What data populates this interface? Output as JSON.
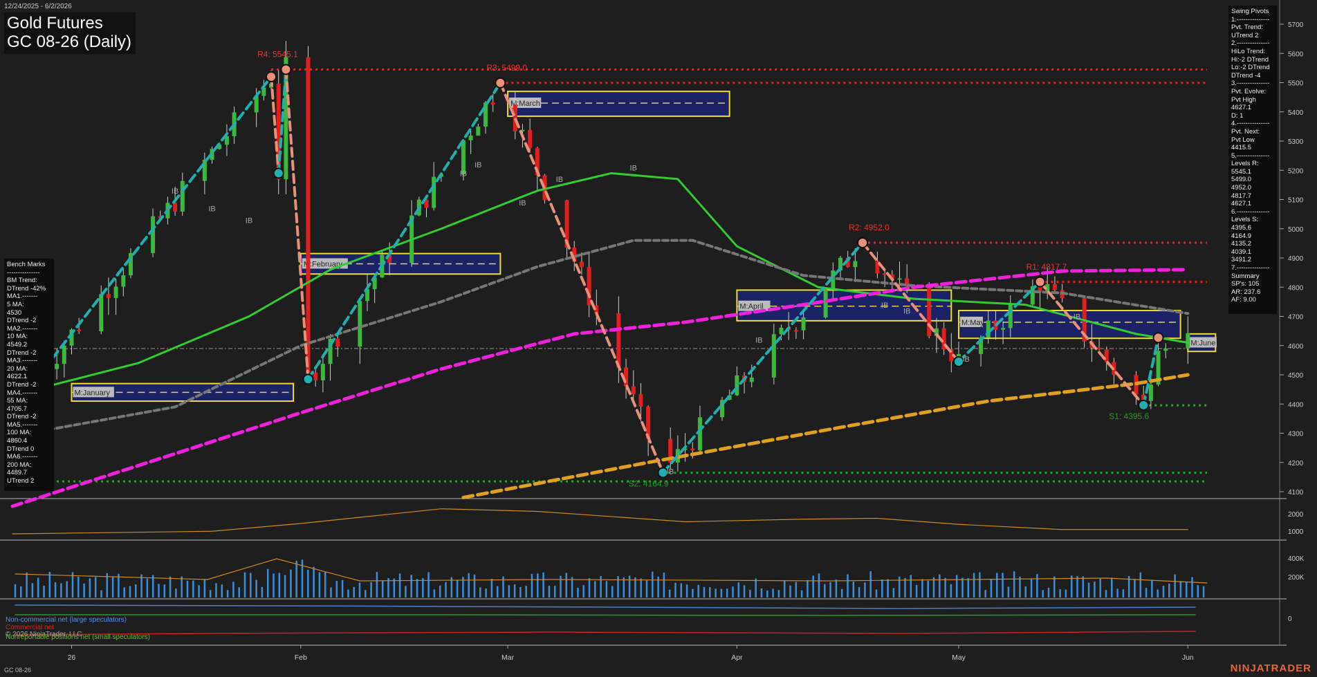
{
  "header": {
    "date_range": "12/24/2025 - 6/2/2026",
    "title_line1": "Gold Futures",
    "title_line2": "GC 08-26 (Daily)"
  },
  "swing_panel_lines": [
    "Swing Pivots",
    "1.---------------",
    "Pvt. Trend:",
    "UTrend 2",
    "2.---------------",
    "HiLo Trend:",
    "Hi:-2 DTrend",
    "Lo:-2 DTrend",
    "DTrend -4",
    "3.---------------",
    "Pvt. Evolve:",
    "Pvt High",
    "4627.1",
    "D: 1",
    "4.---------------",
    "Pvt. Next:",
    "Pvt Low",
    "4415.5",
    "5.---------------",
    "Levels R:",
    "5545.1",
    "5499.0",
    "4952.0",
    "4817.7",
    "4627.1",
    "6.---------------",
    "Levels S:",
    "4395.6",
    "4164.9",
    "4135.2",
    "4039.1",
    "3491.2",
    "7.---------------",
    "Summary",
    "SP's: 105",
    "AR: 237.6",
    "AF: 9.00"
  ],
  "bench_panel_lines": [
    "Bench Marks",
    "---------------",
    "BM Trend:",
    "DTrend -42%",
    "MA1.-------",
    "5 MA:",
    "4530",
    "DTrend -2",
    "MA2.-------",
    "10 MA:",
    "4549.2",
    "DTrend -2",
    "MA3.-------",
    "20 MA:",
    "4622.1",
    "DTrend -2",
    "MA4.-------",
    "55 MA:",
    "4705.7",
    "DTrend -2",
    "MA5.-------",
    "100 MA:",
    "4860.4",
    "DTrend 0",
    "MA6.-------",
    "200 MA:",
    "4489.7",
    "UTrend 2"
  ],
  "legend": {
    "noncommercial": "Non-commercial net (large speculators)",
    "commercial": "Commercial net",
    "nonreportable": "Nonreportable positions net (small speculators)",
    "copyright": "© 2026 NinjaTrader, LLC"
  },
  "footer": {
    "symbol": "GC 08-26",
    "brand": "NINJATRADER"
  },
  "colors": {
    "background": "#1e1e1e",
    "up_candle": "#3cb83c",
    "down_candle": "#e02020",
    "ma_green": "#33cc33",
    "ma_gray": "#777777",
    "ma_magenta": "#ee22dd",
    "ma_orange": "#e0a020",
    "pivot_teal": "#20b0b0",
    "pivot_salmon": "#e8907a",
    "resistance": "#ee2222",
    "support": "#22aa22",
    "volume": "#3a8fe0"
  },
  "chart_data": {
    "type": "candlestick",
    "y_axis": {
      "ticks": [
        4100,
        4200,
        4300,
        4400,
        4500,
        4600,
        4700,
        4800,
        4900,
        5000,
        5100,
        5200,
        5300,
        5400,
        5500,
        5600,
        5700
      ],
      "range": [
        4080,
        5760
      ]
    },
    "x_axis": {
      "tick_labels": [
        {
          "label": "26",
          "date": "2026-01-01"
        },
        {
          "label": "Feb",
          "date": "2026-02-01"
        },
        {
          "label": "Mar",
          "date": "2026-03-01"
        },
        {
          "label": "Apr",
          "date": "2026-04-01"
        },
        {
          "label": "May",
          "date": "2026-05-01"
        },
        {
          "label": "Jun",
          "date": "2026-06-01"
        }
      ],
      "range": [
        "2025-12-24",
        "2026-06-02"
      ]
    },
    "resistance_levels": [
      {
        "label": "R4: 5545.1",
        "value": 5545.1,
        "start": "2026-01-28"
      },
      {
        "label": "R3: 5499.0",
        "value": 5499.0,
        "start": "2026-02-28"
      },
      {
        "label": "R2: 4952.0",
        "value": 4952.0,
        "start": "2026-04-18"
      },
      {
        "label": "R1: 4817.7",
        "value": 4817.7,
        "start": "2026-05-12"
      }
    ],
    "support_levels": [
      {
        "label": "S1: 4395.6",
        "value": 4395.6,
        "start": "2026-05-26"
      },
      {
        "label": "S2: 4164.9",
        "value": 4164.9,
        "start": "2026-03-22"
      },
      {
        "label": "",
        "value": 4135.2,
        "start": "2025-12-24"
      }
    ],
    "monthly_boxes": [
      {
        "label": "M:January",
        "start": "2026-01-01",
        "end": "2026-01-31",
        "high": 4470,
        "low": 4410,
        "mid": 4440
      },
      {
        "label": "M:February",
        "start": "2026-02-01",
        "end": "2026-02-28",
        "high": 4915,
        "low": 4845,
        "mid": 4880
      },
      {
        "label": "M:March",
        "start": "2026-03-01",
        "end": "2026-03-31",
        "high": 5470,
        "low": 5385,
        "mid": 5430
      },
      {
        "label": "M:April",
        "start": "2026-04-01",
        "end": "2026-04-30",
        "high": 4790,
        "low": 4685,
        "mid": 4735
      },
      {
        "label": "M:May",
        "start": "2026-05-01",
        "end": "2026-05-31",
        "high": 4720,
        "low": 4625,
        "mid": 4680
      },
      {
        "label": "M:June",
        "start": "2026-06-01",
        "end": "2026-06-02",
        "high": 4640,
        "low": 4580,
        "mid": 4610
      }
    ],
    "pivot_swings": [
      {
        "date": "2025-12-24",
        "value": 4380
      },
      {
        "date": "2026-01-28",
        "value": 5520
      },
      {
        "date": "2026-01-29",
        "value": 5190
      },
      {
        "date": "2026-01-30",
        "value": 5545
      },
      {
        "date": "2026-02-02",
        "value": 4485
      },
      {
        "date": "2026-02-28",
        "value": 5499
      },
      {
        "date": "2026-03-22",
        "value": 4165
      },
      {
        "date": "2026-04-18",
        "value": 4952
      },
      {
        "date": "2026-05-01",
        "value": 4545
      },
      {
        "date": "2026-05-12",
        "value": 4818
      },
      {
        "date": "2026-05-26",
        "value": 4396
      },
      {
        "date": "2026-05-28",
        "value": 4627
      }
    ],
    "ib_markers": [
      {
        "date": "2026-01-15",
        "value": 5120
      },
      {
        "date": "2026-01-20",
        "value": 5060
      },
      {
        "date": "2026-01-25",
        "value": 5020
      },
      {
        "date": "2026-02-23",
        "value": 5180
      },
      {
        "date": "2026-02-25",
        "value": 5210
      },
      {
        "date": "2026-03-03",
        "value": 5080
      },
      {
        "date": "2026-03-08",
        "value": 5160
      },
      {
        "date": "2026-03-18",
        "value": 5200
      },
      {
        "date": "2026-03-23",
        "value": 4160
      },
      {
        "date": "2026-04-04",
        "value": 4610
      },
      {
        "date": "2026-04-21",
        "value": 4730
      },
      {
        "date": "2026-04-24",
        "value": 4710
      },
      {
        "date": "2026-05-02",
        "value": 4545
      },
      {
        "date": "2026-05-17",
        "value": 4690
      }
    ],
    "moving_averages": [
      {
        "name": "green",
        "points": [
          [
            "2025-12-24",
            4430
          ],
          [
            "2026-01-10",
            4540
          ],
          [
            "2026-01-25",
            4700
          ],
          [
            "2026-02-05",
            4860
          ],
          [
            "2026-02-20",
            5000
          ],
          [
            "2026-03-05",
            5130
          ],
          [
            "2026-03-15",
            5190
          ],
          [
            "2026-03-24",
            5170
          ],
          [
            "2026-04-01",
            4940
          ],
          [
            "2026-04-12",
            4800
          ],
          [
            "2026-04-25",
            4760
          ],
          [
            "2026-05-10",
            4740
          ],
          [
            "2026-05-25",
            4640
          ],
          [
            "2026-06-01",
            4610
          ]
        ]
      },
      {
        "name": "gray",
        "points": [
          [
            "2025-12-24",
            4290
          ],
          [
            "2026-01-15",
            4390
          ],
          [
            "2026-02-01",
            4600
          ],
          [
            "2026-02-20",
            4750
          ],
          [
            "2026-03-05",
            4870
          ],
          [
            "2026-03-18",
            4960
          ],
          [
            "2026-03-26",
            4960
          ],
          [
            "2026-04-10",
            4840
          ],
          [
            "2026-04-25",
            4805
          ],
          [
            "2026-05-15",
            4780
          ],
          [
            "2026-06-01",
            4710
          ]
        ]
      },
      {
        "name": "magenta",
        "points": [
          [
            "2025-12-24",
            4050
          ],
          [
            "2026-01-15",
            4230
          ],
          [
            "2026-02-01",
            4370
          ],
          [
            "2026-02-20",
            4520
          ],
          [
            "2026-03-10",
            4640
          ],
          [
            "2026-03-25",
            4680
          ],
          [
            "2026-04-10",
            4740
          ],
          [
            "2026-04-25",
            4800
          ],
          [
            "2026-05-15",
            4855
          ],
          [
            "2026-06-01",
            4860
          ]
        ]
      },
      {
        "name": "orange",
        "points": [
          [
            "2026-02-23",
            4080
          ],
          [
            "2026-03-20",
            4200
          ],
          [
            "2026-04-15",
            4320
          ],
          [
            "2026-05-05",
            4410
          ],
          [
            "2026-05-25",
            4470
          ],
          [
            "2026-06-01",
            4500
          ]
        ]
      }
    ],
    "oscillator": {
      "ticks": [
        1000,
        2000
      ],
      "series": [
        [
          "2025-12-24",
          1000
        ],
        [
          "2026-01-20",
          1150
        ],
        [
          "2026-02-01",
          1600
        ],
        [
          "2026-02-20",
          2450
        ],
        [
          "2026-03-05",
          2300
        ],
        [
          "2026-03-25",
          1700
        ],
        [
          "2026-04-10",
          1850
        ],
        [
          "2026-04-20",
          1900
        ],
        [
          "2026-05-01",
          1550
        ],
        [
          "2026-05-15",
          1250
        ],
        [
          "2026-06-01",
          1250
        ]
      ]
    },
    "volume": {
      "ticks": [
        "200K",
        "400K"
      ]
    },
    "cot": {
      "ticks": [
        "0"
      ]
    }
  }
}
